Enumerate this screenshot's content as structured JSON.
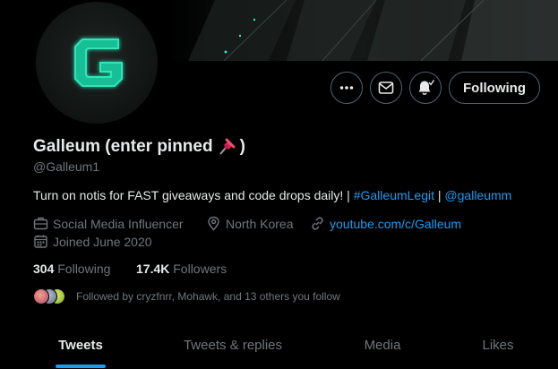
{
  "profile": {
    "display_name": "Galleum (enter pinned ",
    "name_suffix": ")",
    "handle": "@Galleum1",
    "bio_text": "Turn on notis for FAST giveaways and code drops daily! | ",
    "bio_hashtag": "#GalleumLegit",
    "bio_separator": " | ",
    "bio_mention": "@galleumm",
    "category": "Social Media Influencer",
    "location": "North Korea",
    "website": "youtube.com/c/Galleum",
    "joined": "Joined June 2020"
  },
  "stats": {
    "following_count": "304",
    "following_label": "Following",
    "followers_count": "17.4K",
    "followers_label": "Followers"
  },
  "followed_by": {
    "text": "Followed by cryzfnrr, Mohawk, and 13 others you follow"
  },
  "actions": {
    "more_icon": "more-icon",
    "message_icon": "mail-icon",
    "notify_icon": "bell-icon",
    "follow_label": "Following"
  },
  "tabs": [
    {
      "label": "Tweets",
      "active": true
    },
    {
      "label": "Tweets & replies",
      "active": false
    },
    {
      "label": "Media",
      "active": false
    },
    {
      "label": "Likes",
      "active": false
    }
  ],
  "colors": {
    "background": "#000000",
    "accent": "#1d9bf0",
    "text_primary": "#e7e9ea",
    "text_secondary": "#71767b",
    "logo_green": "#2ee6b8"
  }
}
